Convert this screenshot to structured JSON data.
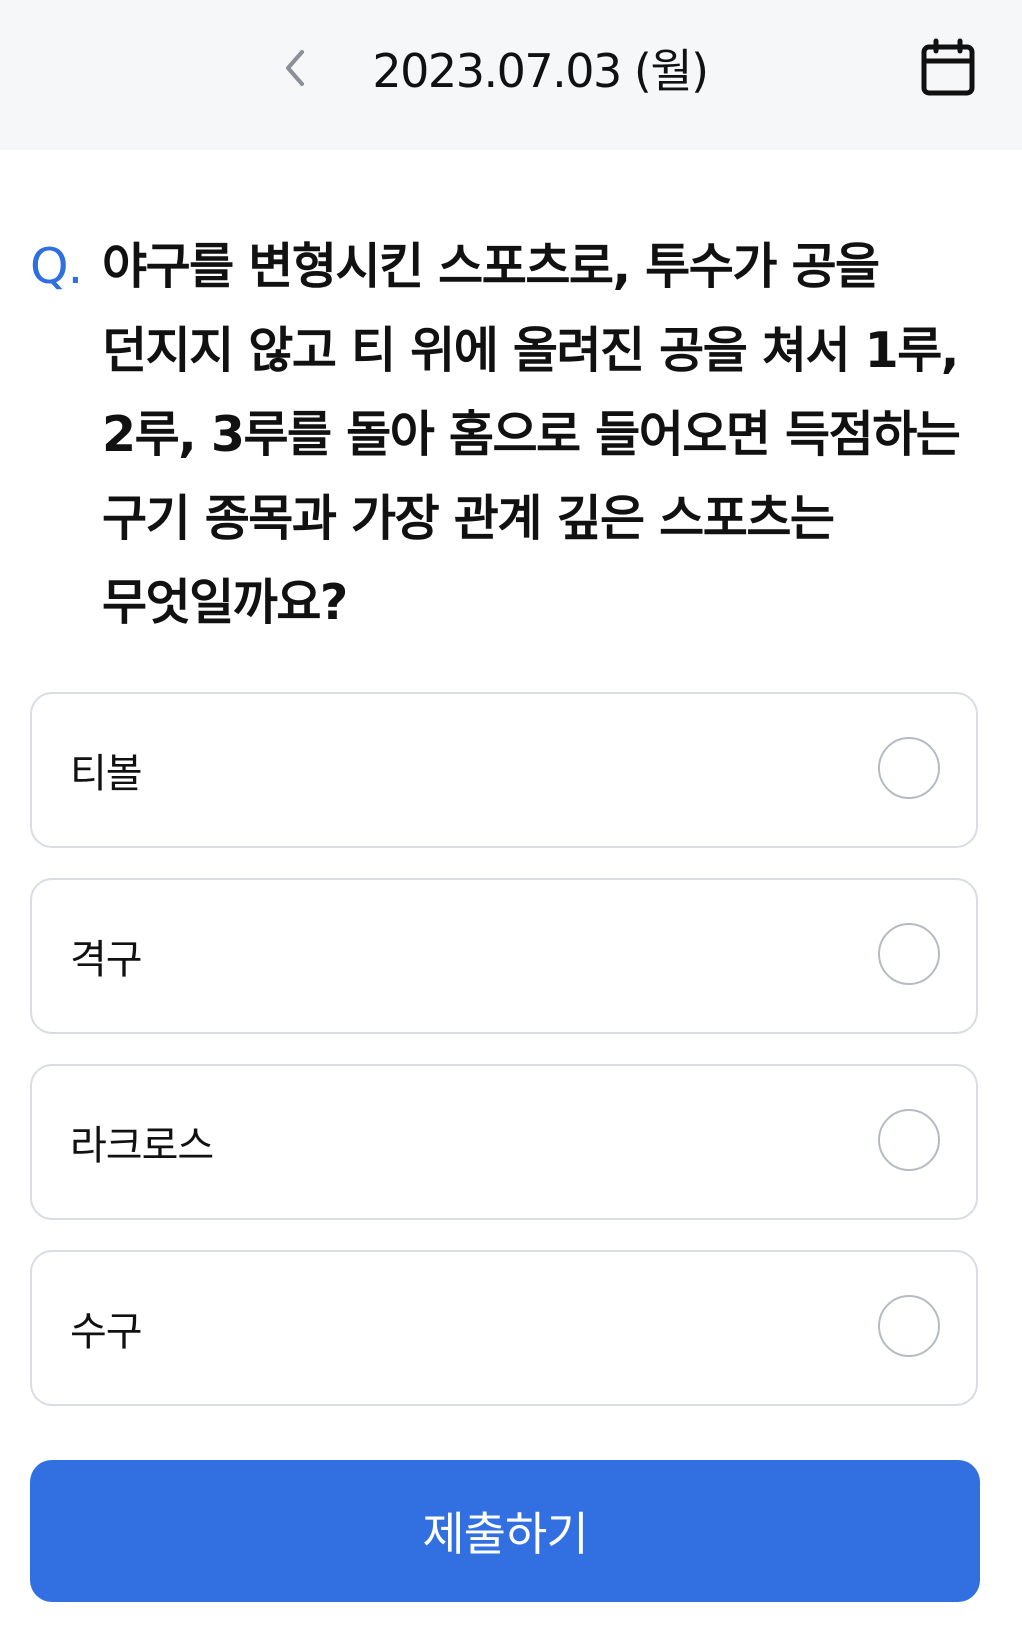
{
  "header": {
    "date": "2023.07.03 (월)",
    "back_icon": "chevron-left-icon",
    "calendar_icon": "calendar-icon"
  },
  "question": {
    "prefix": "Q.",
    "text": "야구를 변형시킨 스포츠로, 투수가 공을 던지지 않고 티 위에 올려진 공을 쳐서 1루, 2루, 3루를 돌아 홈으로 들어오면 득점하는 구기 종목과 가장 관계 깊은 스포츠는 무엇일까요?"
  },
  "options": [
    {
      "label": "티볼",
      "selected": false
    },
    {
      "label": "격구",
      "selected": false
    },
    {
      "label": "라크로스",
      "selected": false
    },
    {
      "label": "수구",
      "selected": false
    }
  ],
  "submit": {
    "label": "제출하기"
  },
  "colors": {
    "accent": "#326fe0",
    "question_prefix": "#2f6fe0",
    "header_bg": "#f6f7f9",
    "option_border": "#d9dde3",
    "radio_border": "#b6bbc3"
  }
}
